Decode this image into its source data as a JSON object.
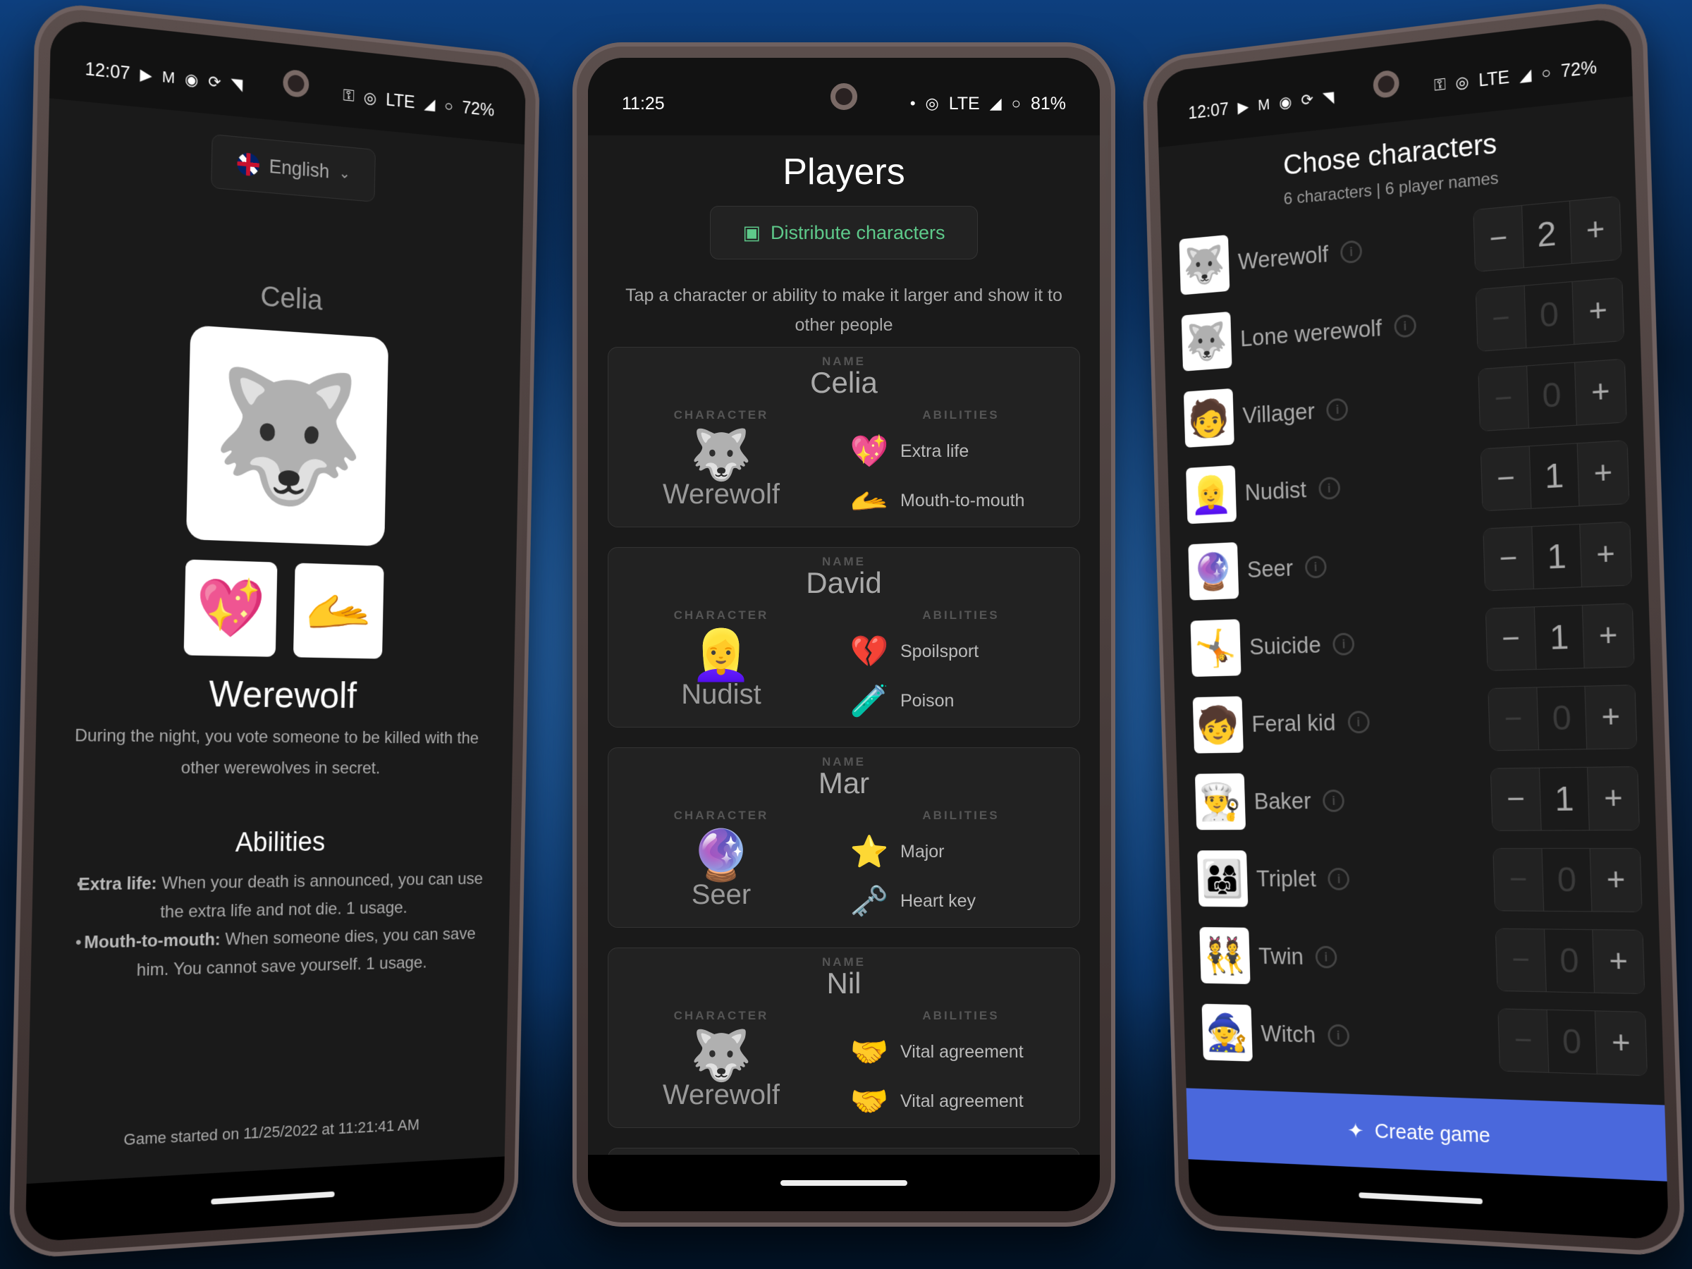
{
  "left": {
    "status": {
      "time": "12:07",
      "network": "LTE",
      "battery": "72%"
    },
    "language": {
      "selected": "English"
    },
    "player_name": "Celia",
    "character": {
      "name": "Werewolf",
      "icon": "werewolf-icon",
      "description": "During the night, you vote someone to be killed with the other werewolves in secret."
    },
    "ability_icons": [
      "extra-life-icon",
      "mouth-to-mouth-icon"
    ],
    "abilities_title": "Abilities",
    "abilities": [
      {
        "name": "Extra life:",
        "text": "When your death is announced, you can use the extra life and not die. 1 usage."
      },
      {
        "name": "Mouth-to-mouth:",
        "text": "When someone dies, you can save him. You cannot save yourself. 1 usage."
      }
    ],
    "started": "Game started on 11/25/2022 at 11:21:41 AM"
  },
  "middle": {
    "status": {
      "time": "11:25",
      "network": "LTE",
      "battery": "81%"
    },
    "title": "Players",
    "distribute_label": "Distribute characters",
    "hint": "Tap a character or ability to make it larger and show it to other people",
    "labels": {
      "name": "NAME",
      "character": "CHARACTER",
      "abilities": "ABILITIES"
    },
    "players": [
      {
        "name": "Celia",
        "character": "Werewolf",
        "icon": "🐺",
        "abilities": [
          {
            "name": "Extra life",
            "icon": "💖"
          },
          {
            "name": "Mouth-to-mouth",
            "icon": "🫴"
          }
        ]
      },
      {
        "name": "David",
        "character": "Nudist",
        "icon": "👱‍♀️",
        "abilities": [
          {
            "name": "Spoilsport",
            "icon": "💔"
          },
          {
            "name": "Poison",
            "icon": "🧪"
          }
        ]
      },
      {
        "name": "Mar",
        "character": "Seer",
        "icon": "🔮",
        "abilities": [
          {
            "name": "Major",
            "icon": "⭐"
          },
          {
            "name": "Heart key",
            "icon": "🗝️"
          }
        ]
      },
      {
        "name": "Nil",
        "character": "Werewolf",
        "icon": "🐺",
        "abilities": [
          {
            "name": "Vital agreement",
            "icon": "🤝"
          },
          {
            "name": "Vital agreement",
            "icon": "🤝"
          }
        ]
      }
    ]
  },
  "right": {
    "status": {
      "time": "12:07",
      "network": "LTE",
      "battery": "72%"
    },
    "title": "Chose characters",
    "subtitle": "6 characters | 6 player names",
    "characters": [
      {
        "name": "Werewolf",
        "icon": "🐺",
        "count": 2
      },
      {
        "name": "Lone werewolf",
        "icon": "🐺",
        "count": 0
      },
      {
        "name": "Villager",
        "icon": "🧑",
        "count": 0
      },
      {
        "name": "Nudist",
        "icon": "👱‍♀️",
        "count": 1
      },
      {
        "name": "Seer",
        "icon": "🔮",
        "count": 1
      },
      {
        "name": "Suicide",
        "icon": "🤸",
        "count": 1
      },
      {
        "name": "Feral kid",
        "icon": "🧒",
        "count": 0
      },
      {
        "name": "Baker",
        "icon": "👨‍🍳",
        "count": 1
      },
      {
        "name": "Triplet",
        "icon": "👨‍👩‍👧",
        "count": 0
      },
      {
        "name": "Twin",
        "icon": "👯",
        "count": 0
      },
      {
        "name": "Witch",
        "icon": "🧙",
        "count": 0
      }
    ],
    "create_label": "Create game",
    "accent": "#4a68dc"
  }
}
